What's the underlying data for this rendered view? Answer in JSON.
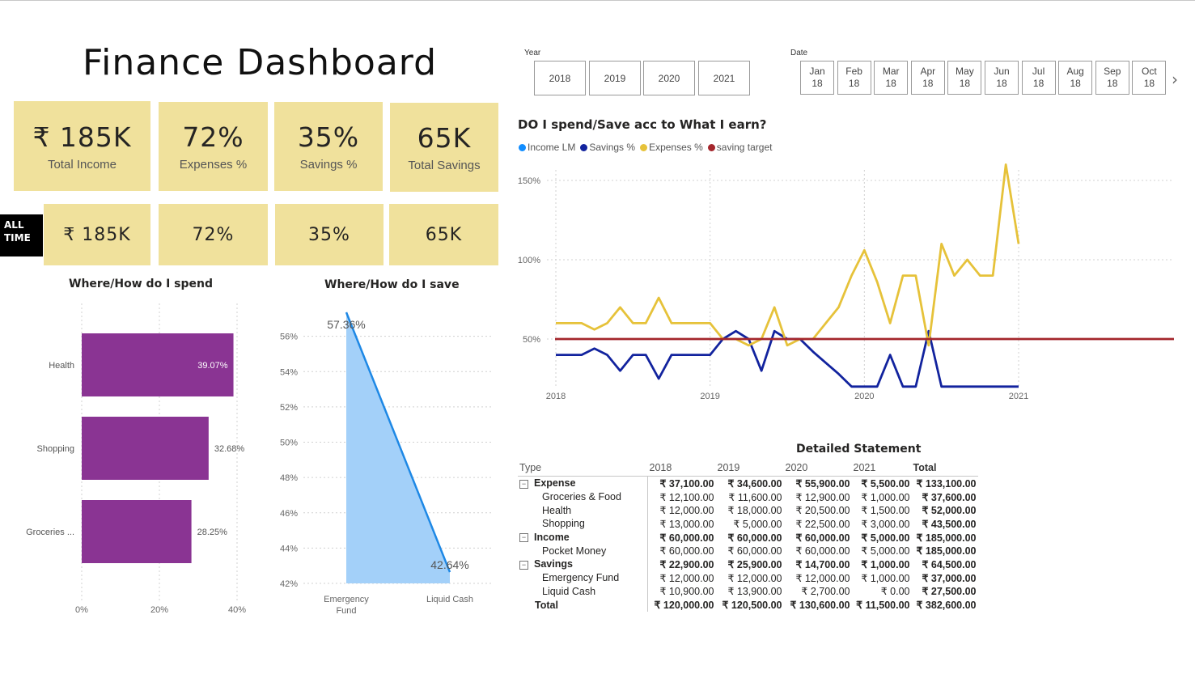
{
  "dashboard": {
    "title": "Finance Dashboard"
  },
  "kpis_top": [
    {
      "value": "₹ 185K",
      "label": "Total Income"
    },
    {
      "value": "72%",
      "label": "Expenses %"
    },
    {
      "value": "35%",
      "label": "Savings %"
    },
    {
      "value": "65K",
      "label": "Total Savings"
    }
  ],
  "kpis_all_time": {
    "label": "ALL TIME",
    "values": [
      "₹ 185K",
      "72%",
      "35%",
      "65K"
    ]
  },
  "year_slicer": {
    "label": "Year",
    "options": [
      "2018",
      "2019",
      "2020",
      "2021"
    ]
  },
  "date_slicer": {
    "label": "Date",
    "options": [
      [
        "Jan",
        "18"
      ],
      [
        "Feb",
        "18"
      ],
      [
        "Mar",
        "18"
      ],
      [
        "Apr",
        "18"
      ],
      [
        "May",
        "18"
      ],
      [
        "Jun",
        "18"
      ],
      [
        "Jul",
        "18"
      ],
      [
        "Aug",
        "18"
      ],
      [
        "Sep",
        "18"
      ],
      [
        "Oct",
        "18"
      ]
    ],
    "next_icon": "chevron-right-icon"
  },
  "colors": {
    "kpi_bg": "#f0e19c",
    "spend_bar": "#8a3493",
    "save_line": "#1e88e5",
    "save_fill": "#a3d0f9",
    "income_lm": "#118dff",
    "savings_pct": "#12239e",
    "expenses_pct": "#e6c23a",
    "saving_target": "#a4262c"
  },
  "chart_data": [
    {
      "type": "bar",
      "title": "Where/How do I spend",
      "orientation": "horizontal",
      "categories": [
        "Health",
        "Shopping",
        "Groceries ..."
      ],
      "values": [
        39.07,
        32.68,
        28.25
      ],
      "data_labels": [
        "39.07%",
        "32.68%",
        "28.25%"
      ],
      "xlim": [
        0,
        40
      ],
      "x_ticks": [
        "0%",
        "20%",
        "40%"
      ],
      "grid": true
    },
    {
      "type": "area",
      "title": "Where/How do I save",
      "categories": [
        "Emergency Fund",
        "Liquid Cash"
      ],
      "category_labels": [
        [
          "Emergency",
          "Fund"
        ],
        [
          "Liquid Cash"
        ]
      ],
      "values": [
        57.36,
        42.64
      ],
      "data_labels": [
        "57.36%",
        "42.64%"
      ],
      "ylim": [
        42,
        57.36
      ],
      "y_ticks": [
        "42%",
        "44%",
        "46%",
        "48%",
        "50%",
        "52%",
        "54%",
        "56%"
      ],
      "grid": true
    },
    {
      "type": "line",
      "title": "DO I spend/Save acc to What I earn?",
      "x_ticks": [
        "2018",
        "2019",
        "2020",
        "2021"
      ],
      "x_range": [
        2018,
        2021
      ],
      "y_ticks": [
        "50%",
        "100%",
        "150%"
      ],
      "ylim": [
        20,
        160
      ],
      "legend_position": "top-left",
      "series": [
        {
          "name": "Income LM",
          "x": [],
          "y": []
        },
        {
          "name": "Savings %",
          "x": [
            2018,
            2018.083,
            2018.167,
            2018.25,
            2018.333,
            2018.417,
            2018.5,
            2018.583,
            2018.667,
            2018.75,
            2018.833,
            2018.917,
            2019,
            2019.083,
            2019.167,
            2019.25,
            2019.333,
            2019.417,
            2019.5,
            2019.583,
            2019.667,
            2019.75,
            2019.833,
            2019.917,
            2020,
            2020.083,
            2020.167,
            2020.25,
            2020.333,
            2020.417,
            2020.5,
            2020.583,
            2020.667,
            2020.75,
            2020.833,
            2020.917,
            2021
          ],
          "y": [
            40,
            40,
            40,
            44,
            40,
            30,
            40,
            40,
            25,
            40,
            40,
            40,
            40,
            50,
            55,
            50,
            30,
            55,
            50,
            50,
            42,
            35,
            28,
            20,
            20,
            20,
            40,
            20,
            20,
            55,
            20,
            20,
            20,
            20,
            20,
            20,
            20
          ]
        },
        {
          "name": "Expenses %",
          "x": [
            2018,
            2018.083,
            2018.167,
            2018.25,
            2018.333,
            2018.417,
            2018.5,
            2018.583,
            2018.667,
            2018.75,
            2018.833,
            2018.917,
            2019,
            2019.083,
            2019.167,
            2019.25,
            2019.333,
            2019.417,
            2019.5,
            2019.583,
            2019.667,
            2019.75,
            2019.833,
            2019.917,
            2020,
            2020.083,
            2020.167,
            2020.25,
            2020.333,
            2020.417,
            2020.5,
            2020.583,
            2020.667,
            2020.75,
            2020.833,
            2020.917,
            2021
          ],
          "y": [
            60,
            60,
            60,
            56,
            60,
            70,
            60,
            60,
            76,
            60,
            60,
            60,
            60,
            50,
            50,
            46,
            50,
            70,
            46,
            50,
            50,
            60,
            70,
            90,
            106,
            86,
            60,
            90,
            90,
            46,
            110,
            90,
            100,
            90,
            90,
            160,
            110
          ]
        },
        {
          "name": "saving target",
          "x": [
            2018,
            2022
          ],
          "y": [
            50,
            50
          ]
        }
      ]
    }
  ],
  "statement": {
    "title": "Detailed Statement",
    "columns": [
      "Type",
      "2018",
      "2019",
      "2020",
      "2021",
      "Total"
    ],
    "rows": [
      {
        "kind": "group",
        "label": "Expense",
        "values": [
          "₹ 37,100.00",
          "₹ 34,600.00",
          "₹ 55,900.00",
          "₹ 5,500.00",
          "₹ 133,100.00"
        ]
      },
      {
        "kind": "child",
        "label": "Groceries & Food",
        "values": [
          "₹ 12,100.00",
          "₹ 11,600.00",
          "₹ 12,900.00",
          "₹ 1,000.00",
          "₹ 37,600.00"
        ]
      },
      {
        "kind": "child",
        "label": "Health",
        "values": [
          "₹ 12,000.00",
          "₹ 18,000.00",
          "₹ 20,500.00",
          "₹ 1,500.00",
          "₹ 52,000.00"
        ]
      },
      {
        "kind": "child",
        "label": "Shopping",
        "values": [
          "₹ 13,000.00",
          "₹ 5,000.00",
          "₹ 22,500.00",
          "₹ 3,000.00",
          "₹ 43,500.00"
        ]
      },
      {
        "kind": "group",
        "label": "Income",
        "values": [
          "₹ 60,000.00",
          "₹ 60,000.00",
          "₹ 60,000.00",
          "₹ 5,000.00",
          "₹ 185,000.00"
        ]
      },
      {
        "kind": "child",
        "label": "Pocket Money",
        "values": [
          "₹ 60,000.00",
          "₹ 60,000.00",
          "₹ 60,000.00",
          "₹ 5,000.00",
          "₹ 185,000.00"
        ]
      },
      {
        "kind": "group",
        "label": "Savings",
        "values": [
          "₹ 22,900.00",
          "₹ 25,900.00",
          "₹ 14,700.00",
          "₹ 1,000.00",
          "₹ 64,500.00"
        ]
      },
      {
        "kind": "child",
        "label": "Emergency Fund",
        "values": [
          "₹ 12,000.00",
          "₹ 12,000.00",
          "₹ 12,000.00",
          "₹ 1,000.00",
          "₹ 37,000.00"
        ]
      },
      {
        "kind": "child",
        "label": "Liquid Cash",
        "values": [
          "₹ 10,900.00",
          "₹ 13,900.00",
          "₹ 2,700.00",
          "₹ 0.00",
          "₹ 27,500.00"
        ]
      },
      {
        "kind": "total",
        "label": "Total",
        "values": [
          "₹ 120,000.00",
          "₹ 120,500.00",
          "₹ 130,600.00",
          "₹ 11,500.00",
          "₹ 382,600.00"
        ]
      }
    ]
  }
}
